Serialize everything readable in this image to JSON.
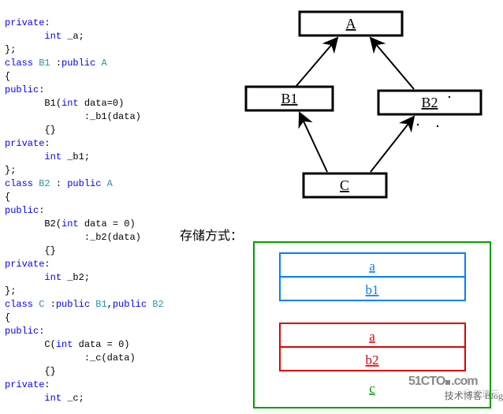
{
  "code": {
    "indent1": "private",
    "l1b": "int",
    "l1c": "_a",
    "l2a": "class",
    "l2b": "B1",
    "l2c": "public",
    "l2d": "A",
    "l3a": "public",
    "l4a": "B1",
    "l4b": "int",
    "l4c": "data",
    "l4d": "0",
    "l5a": "_b1",
    "l5b": "data",
    "l6a": "private",
    "l6b": "int",
    "l6c": "_b1",
    "l7a": "class",
    "l7b": "B2",
    "l7c": "public",
    "l7d": "A",
    "l8a": "public",
    "l9a": "B2",
    "l9b": "int",
    "l9c": "data",
    "l9d": "0",
    "l10a": "_b2",
    "l10b": "data",
    "l11a": "private",
    "l11b": "int",
    "l11c": "_b2",
    "l12a": "class",
    "l12b": "C",
    "l12c": "public",
    "l12d": "B1",
    "l12e": "public",
    "l12f": "B2",
    "l13a": "public",
    "l14a": "C",
    "l14b": "int",
    "l14c": "data",
    "l14d": "0",
    "l15a": "_c",
    "l15b": "data",
    "l16a": "private",
    "l16b": "int",
    "l16c": "_c"
  },
  "diagram": {
    "nodes": {
      "a": "A",
      "b1": "B1",
      "b2": "B2",
      "c": "C"
    }
  },
  "storage": {
    "caption": "存储方式：",
    "rows": {
      "a1": "a",
      "b1": "b1",
      "a2": "a",
      "b2": "b2",
      "c": "c"
    }
  },
  "watermark": {
    "brand_left": "51CTO",
    "brand_right": ".com",
    "sub": "技术博客    Blog",
    "mini": "亿速云"
  }
}
